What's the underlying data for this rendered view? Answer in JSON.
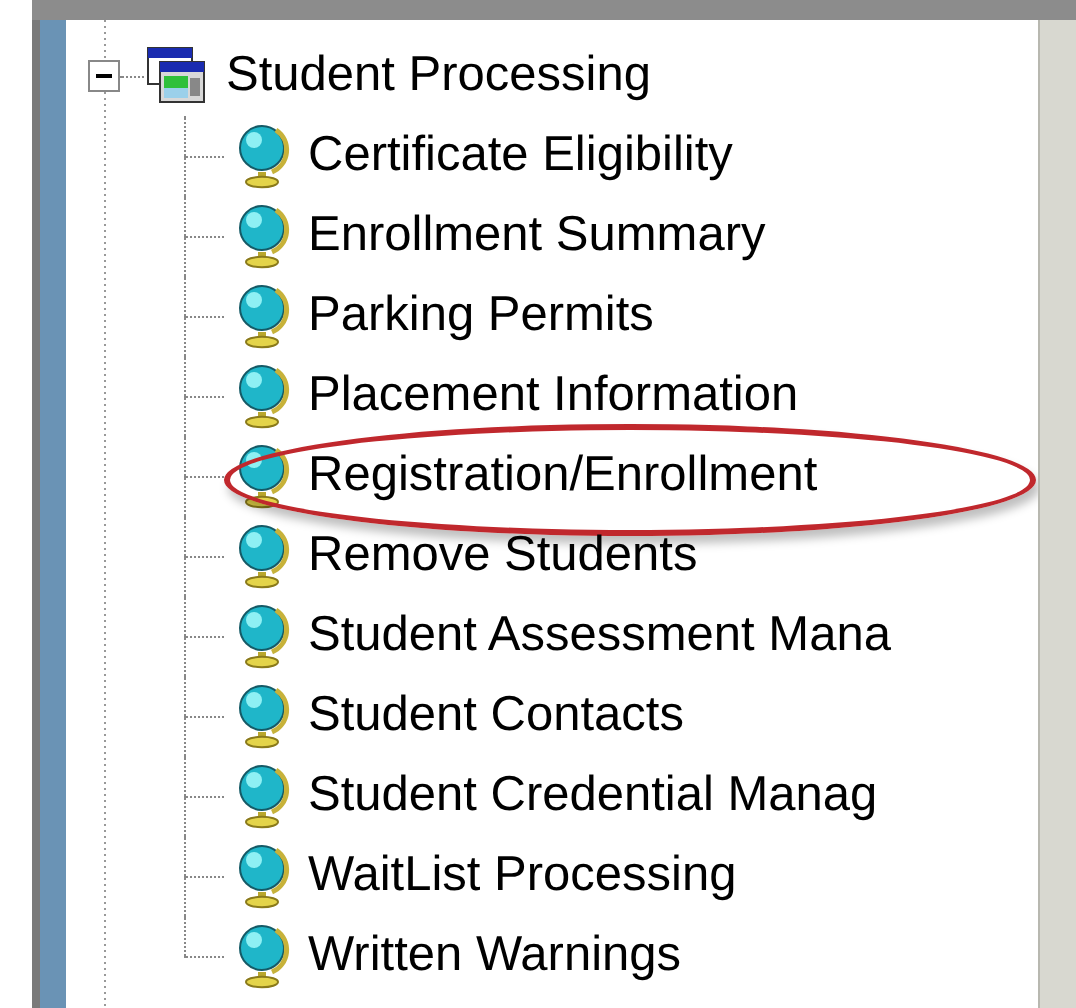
{
  "tree": {
    "label": "Student Processing",
    "expanded": true,
    "children": [
      {
        "label": "Certificate Eligibility",
        "circled": false
      },
      {
        "label": "Enrollment Summary",
        "circled": false
      },
      {
        "label": "Parking Permits",
        "circled": false
      },
      {
        "label": "Placement Information",
        "circled": false
      },
      {
        "label": "Registration/Enrollment",
        "circled": true
      },
      {
        "label": "Remove Students",
        "circled": false
      },
      {
        "label": "Student Assessment Mana",
        "circled": false
      },
      {
        "label": "Student Contacts",
        "circled": false
      },
      {
        "label": "Student Credential Manag",
        "circled": false
      },
      {
        "label": "WaitList Processing",
        "circled": false
      },
      {
        "label": "Written Warnings",
        "circled": false
      }
    ]
  }
}
